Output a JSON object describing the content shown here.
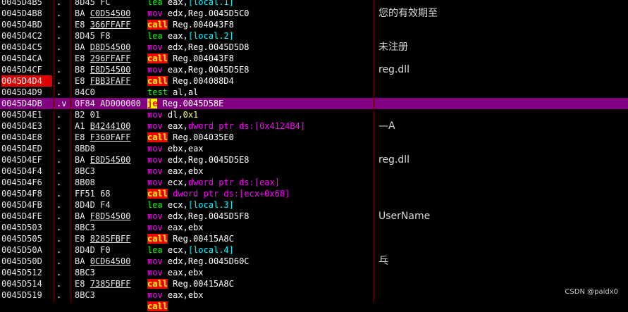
{
  "colors": {
    "background": "#000000",
    "selected_row": "#800080",
    "eip_highlight": "#e00000",
    "separator": "#6b0000"
  },
  "watermark": "CSDN @paidx0",
  "rows": [
    {
      "addr": "0045D4B5",
      "mark": ".",
      "hex": "8D45 FC",
      "asm": [
        [
          "lea",
          "kw-lea"
        ],
        [
          " ",
          "plain"
        ],
        [
          "eax",
          "reg"
        ],
        [
          ",",
          "plain"
        ],
        [
          "[local.1]",
          "local"
        ]
      ],
      "comment": ""
    },
    {
      "addr": "0045D4B8",
      "mark": ".",
      "hex": "BA C0D54500",
      "asm": [
        [
          "mov",
          "kw-mov"
        ],
        [
          " ",
          "plain"
        ],
        [
          "edx",
          "reg"
        ],
        [
          ",Reg.0045D5C0",
          "plain"
        ]
      ],
      "comment": "您的有效期至"
    },
    {
      "addr": "0045D4BD",
      "mark": ".",
      "hex": "E8 366FFAFF",
      "asm": [
        [
          "call",
          "kw-call"
        ],
        [
          " Reg.004043F8",
          "plain"
        ]
      ],
      "comment": ""
    },
    {
      "addr": "0045D4C2",
      "mark": ".",
      "hex": "8D45 F8",
      "asm": [
        [
          "lea",
          "kw-lea"
        ],
        [
          " ",
          "plain"
        ],
        [
          "eax",
          "reg"
        ],
        [
          ",",
          "plain"
        ],
        [
          "[local.2]",
          "local"
        ]
      ],
      "comment": ""
    },
    {
      "addr": "0045D4C5",
      "mark": ".",
      "hex": "BA D8D54500",
      "asm": [
        [
          "mov",
          "kw-mov"
        ],
        [
          " ",
          "plain"
        ],
        [
          "edx",
          "reg"
        ],
        [
          ",Reg.0045D5D8",
          "plain"
        ]
      ],
      "comment": "未注册"
    },
    {
      "addr": "0045D4CA",
      "mark": ".",
      "hex": "E8 296FFAFF",
      "asm": [
        [
          "call",
          "kw-call"
        ],
        [
          " Reg.004043F8",
          "plain"
        ]
      ],
      "comment": ""
    },
    {
      "addr": "0045D4CF",
      "mark": ".",
      "hex": "B8 E8D54500",
      "asm": [
        [
          "mov",
          "kw-mov"
        ],
        [
          " ",
          "plain"
        ],
        [
          "eax",
          "reg"
        ],
        [
          ",Reg.0045D5E8",
          "plain"
        ]
      ],
      "comment": "reg.dll"
    },
    {
      "addr": "0045D4D4",
      "mark": ".",
      "hex": "E8 FBB3FAFF",
      "asm": [
        [
          "call",
          "kw-call"
        ],
        [
          " Reg.004088D4",
          "plain"
        ]
      ],
      "comment": "",
      "addr_hl": true
    },
    {
      "addr": "0045D4D9",
      "mark": ".",
      "hex": "84C0",
      "asm": [
        [
          "test",
          "kw-test"
        ],
        [
          " ",
          "plain"
        ],
        [
          "al",
          "reg"
        ],
        [
          ",",
          "plain"
        ],
        [
          "al",
          "reg"
        ]
      ],
      "comment": ""
    },
    {
      "addr": "0045D4DB",
      "mark": ".v",
      "hex": "0F84 AD000000",
      "asm": [
        [
          "je",
          "kw-je"
        ],
        [
          " Reg.0045D58E",
          "plain"
        ]
      ],
      "comment": "",
      "selected": true
    },
    {
      "addr": "0045D4E1",
      "mark": ".",
      "hex": "B2 01",
      "asm": [
        [
          "mov",
          "kw-mov"
        ],
        [
          " ",
          "plain"
        ],
        [
          "dl",
          "reg"
        ],
        [
          ",",
          "plain"
        ],
        [
          "0x1",
          "num"
        ]
      ],
      "comment": ""
    },
    {
      "addr": "0045D4E3",
      "mark": ".",
      "hex": "A1 B4244100",
      "asm": [
        [
          "mov",
          "kw-mov"
        ],
        [
          " ",
          "plain"
        ],
        [
          "eax",
          "reg"
        ],
        [
          ",",
          "plain"
        ],
        [
          "dword ptr ds:[0x4124B4]",
          "mem"
        ]
      ],
      "comment": "—A"
    },
    {
      "addr": "0045D4E8",
      "mark": ".",
      "hex": "E8 F360FAFF",
      "asm": [
        [
          "call",
          "kw-call"
        ],
        [
          " Reg.004035E0",
          "plain"
        ]
      ],
      "comment": ""
    },
    {
      "addr": "0045D4ED",
      "mark": ".",
      "hex": "8BD8",
      "asm": [
        [
          "mov",
          "kw-mov"
        ],
        [
          " ",
          "plain"
        ],
        [
          "ebx",
          "reg"
        ],
        [
          ",",
          "plain"
        ],
        [
          "eax",
          "reg"
        ]
      ],
      "comment": ""
    },
    {
      "addr": "0045D4EF",
      "mark": ".",
      "hex": "BA E8D54500",
      "asm": [
        [
          "mov",
          "kw-mov"
        ],
        [
          " ",
          "plain"
        ],
        [
          "edx",
          "reg"
        ],
        [
          ",Reg.0045D5E8",
          "plain"
        ]
      ],
      "comment": "reg.dll"
    },
    {
      "addr": "0045D4F4",
      "mark": ".",
      "hex": "8BC3",
      "asm": [
        [
          "mov",
          "kw-mov"
        ],
        [
          " ",
          "plain"
        ],
        [
          "eax",
          "reg"
        ],
        [
          ",",
          "plain"
        ],
        [
          "ebx",
          "reg"
        ]
      ],
      "comment": ""
    },
    {
      "addr": "0045D4F6",
      "mark": ".",
      "hex": "8B08",
      "asm": [
        [
          "mov",
          "kw-mov"
        ],
        [
          " ",
          "plain"
        ],
        [
          "ecx",
          "reg"
        ],
        [
          ",",
          "plain"
        ],
        [
          "dword ptr ds:[eax]",
          "mem"
        ]
      ],
      "comment": ""
    },
    {
      "addr": "0045D4F8",
      "mark": ".",
      "hex": "FF51 68",
      "asm": [
        [
          "call",
          "kw-call"
        ],
        [
          " ",
          "plain"
        ],
        [
          "dword ptr ds:[ecx+0x68]",
          "mem"
        ]
      ],
      "comment": ""
    },
    {
      "addr": "0045D4FB",
      "mark": ".",
      "hex": "8D4D F4",
      "asm": [
        [
          "lea",
          "kw-lea"
        ],
        [
          " ",
          "plain"
        ],
        [
          "ecx",
          "reg"
        ],
        [
          ",",
          "plain"
        ],
        [
          "[local.3]",
          "local"
        ]
      ],
      "comment": ""
    },
    {
      "addr": "0045D4FE",
      "mark": ".",
      "hex": "BA F8D54500",
      "asm": [
        [
          "mov",
          "kw-mov"
        ],
        [
          " ",
          "plain"
        ],
        [
          "edx",
          "reg"
        ],
        [
          ",Reg.0045D5F8",
          "plain"
        ]
      ],
      "comment": "UserName"
    },
    {
      "addr": "0045D503",
      "mark": ".",
      "hex": "8BC3",
      "asm": [
        [
          "mov",
          "kw-mov"
        ],
        [
          " ",
          "plain"
        ],
        [
          "eax",
          "reg"
        ],
        [
          ",",
          "plain"
        ],
        [
          "ebx",
          "reg"
        ]
      ],
      "comment": ""
    },
    {
      "addr": "0045D505",
      "mark": ".",
      "hex": "E8 8285FBFF",
      "asm": [
        [
          "call",
          "kw-call"
        ],
        [
          " Reg.00415A8C",
          "plain"
        ]
      ],
      "comment": ""
    },
    {
      "addr": "0045D50A",
      "mark": ".",
      "hex": "8D4D F0",
      "asm": [
        [
          "lea",
          "kw-lea"
        ],
        [
          " ",
          "plain"
        ],
        [
          "ecx",
          "reg"
        ],
        [
          ",",
          "plain"
        ],
        [
          "[local.4]",
          "local"
        ]
      ],
      "comment": ""
    },
    {
      "addr": "0045D50D",
      "mark": ".",
      "hex": "BA 0CD64500",
      "asm": [
        [
          "mov",
          "kw-mov"
        ],
        [
          " ",
          "plain"
        ],
        [
          "edx",
          "reg"
        ],
        [
          ",Reg.0045D60C",
          "plain"
        ]
      ],
      "comment": "乓"
    },
    {
      "addr": "0045D512",
      "mark": ".",
      "hex": "8BC3",
      "asm": [
        [
          "mov",
          "kw-mov"
        ],
        [
          " ",
          "plain"
        ],
        [
          "eax",
          "reg"
        ],
        [
          ",",
          "plain"
        ],
        [
          "ebx",
          "reg"
        ]
      ],
      "comment": ""
    },
    {
      "addr": "0045D514",
      "mark": ".",
      "hex": "E8 7385FBFF",
      "asm": [
        [
          "call",
          "kw-call"
        ],
        [
          " Reg.00415A8C",
          "plain"
        ]
      ],
      "comment": ""
    },
    {
      "addr": "0045D519",
      "mark": ".",
      "hex": "8BC3",
      "asm": [
        [
          "mov",
          "kw-mov"
        ],
        [
          " ",
          "plain"
        ],
        [
          "eax",
          "reg"
        ],
        [
          ",",
          "plain"
        ],
        [
          "ebx",
          "reg"
        ]
      ],
      "comment": ""
    },
    {
      "addr": "",
      "mark": "",
      "hex": "",
      "asm": [
        [
          "call",
          "kw-call"
        ]
      ],
      "comment": ""
    }
  ]
}
